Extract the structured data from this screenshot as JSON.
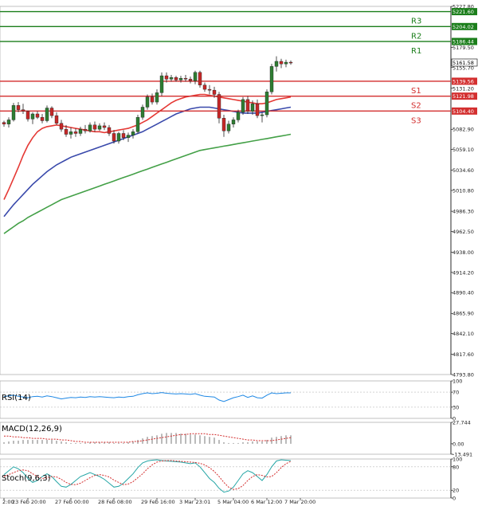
{
  "chart_data": {
    "type": "candlestick",
    "title": "",
    "colors": {
      "up": "#2e7d32",
      "down": "#c62828",
      "ma_fast": "#e53935",
      "ma_mid": "#3949ab",
      "ma_slow": "#43a047",
      "resistance": "#1b7e1b",
      "support": "#d32f2f",
      "rsi": "#1e88e5",
      "macd_hist": "#9e9e9e",
      "macd_signal": "#d32f2f",
      "stoch_main": "#26a6a6",
      "stoch_signal": "#d32f2f",
      "grid": "#cccccc"
    },
    "main": {
      "ylim": [
        4793.8,
        5227.8
      ],
      "y_ticks": [
        "5227.80",
        "5179.50",
        "5155.70",
        "5131.20",
        "5082.90",
        "5059.10",
        "5034.60",
        "5010.80",
        "4986.30",
        "4962.50",
        "4938.00",
        "4914.20",
        "4890.40",
        "4865.90",
        "4842.10",
        "4817.60",
        "4793.80"
      ],
      "levels": [
        {
          "name": "R3",
          "value": 5221.6,
          "label": "5221.60",
          "kind": "resistance"
        },
        {
          "name": "R2",
          "value": 5204.02,
          "label": "5204.02",
          "kind": "resistance"
        },
        {
          "name": "R1",
          "value": 5186.44,
          "label": "5186.44",
          "kind": "resistance"
        },
        {
          "name": "S1",
          "value": 5139.56,
          "label": "5139.56",
          "kind": "support"
        },
        {
          "name": "S2",
          "value": 5121.98,
          "label": "5121.98",
          "kind": "support"
        },
        {
          "name": "S3",
          "value": 5104.4,
          "label": "5104.40",
          "kind": "support"
        }
      ],
      "current_price": {
        "value": 5161.58,
        "label": "5161.58"
      },
      "candles": [
        [
          5091,
          5093,
          5086,
          5089
        ],
        [
          5089,
          5097,
          5085,
          5094
        ],
        [
          5094,
          5114,
          5092,
          5111
        ],
        [
          5111,
          5115,
          5103,
          5106
        ],
        [
          5106,
          5113,
          5101,
          5104
        ],
        [
          5104,
          5105,
          5092,
          5095
        ],
        [
          5095,
          5103,
          5089,
          5101
        ],
        [
          5101,
          5104,
          5095,
          5097
        ],
        [
          5097,
          5101,
          5090,
          5093
        ],
        [
          5093,
          5111,
          5091,
          5108
        ],
        [
          5108,
          5110,
          5096,
          5099
        ],
        [
          5099,
          5103,
          5088,
          5090
        ],
        [
          5090,
          5094,
          5080,
          5083
        ],
        [
          5083,
          5088,
          5074,
          5077
        ],
        [
          5077,
          5085,
          5072,
          5080
        ],
        [
          5080,
          5084,
          5074,
          5078
        ],
        [
          5078,
          5086,
          5075,
          5083
        ],
        [
          5083,
          5088,
          5078,
          5081
        ],
        [
          5081,
          5091,
          5079,
          5088
        ],
        [
          5088,
          5092,
          5080,
          5083
        ],
        [
          5083,
          5090,
          5081,
          5087
        ],
        [
          5087,
          5091,
          5082,
          5085
        ],
        [
          5085,
          5088,
          5075,
          5078
        ],
        [
          5078,
          5082,
          5066,
          5069
        ],
        [
          5069,
          5080,
          5066,
          5078
        ],
        [
          5078,
          5082,
          5070,
          5073
        ],
        [
          5073,
          5079,
          5068,
          5076
        ],
        [
          5076,
          5083,
          5072,
          5080
        ],
        [
          5080,
          5100,
          5078,
          5097
        ],
        [
          5097,
          5112,
          5094,
          5109
        ],
        [
          5109,
          5124,
          5106,
          5121
        ],
        [
          5121,
          5125,
          5112,
          5115
        ],
        [
          5115,
          5130,
          5112,
          5126
        ],
        [
          5126,
          5150,
          5122,
          5146
        ],
        [
          5146,
          5150,
          5138,
          5142
        ],
        [
          5142,
          5147,
          5139,
          5144
        ],
        [
          5144,
          5146,
          5139,
          5141
        ],
        [
          5141,
          5146,
          5138,
          5143
        ],
        [
          5143,
          5147,
          5139,
          5142
        ],
        [
          5142,
          5145,
          5137,
          5140
        ],
        [
          5140,
          5152,
          5136,
          5150
        ],
        [
          5150,
          5152,
          5132,
          5135
        ],
        [
          5135,
          5138,
          5127,
          5130
        ],
        [
          5130,
          5135,
          5124,
          5129
        ],
        [
          5129,
          5133,
          5120,
          5124
        ],
        [
          5124,
          5127,
          5090,
          5096
        ],
        [
          5096,
          5100,
          5074,
          5081
        ],
        [
          5081,
          5093,
          5078,
          5089
        ],
        [
          5089,
          5097,
          5085,
          5094
        ],
        [
          5094,
          5106,
          5091,
          5103
        ],
        [
          5103,
          5121,
          5100,
          5118
        ],
        [
          5118,
          5122,
          5101,
          5104
        ],
        [
          5104,
          5117,
          5100,
          5113
        ],
        [
          5113,
          5118,
          5096,
          5099
        ],
        [
          5099,
          5103,
          5091,
          5100
        ],
        [
          5100,
          5130,
          5097,
          5127
        ],
        [
          5127,
          5160,
          5124,
          5157
        ],
        [
          5157,
          5169,
          5151,
          5163
        ],
        [
          5163,
          5166,
          5155,
          5160
        ],
        [
          5160,
          5165,
          5156,
          5162
        ],
        [
          5162,
          5164,
          5159,
          5161.58
        ]
      ],
      "ma_fast": [
        5000,
        5012,
        5025,
        5038,
        5052,
        5064,
        5073,
        5080,
        5084,
        5086,
        5087,
        5088,
        5087,
        5086,
        5085,
        5084,
        5083,
        5082,
        5081,
        5080,
        5080,
        5079,
        5080,
        5081,
        5082,
        5083,
        5084,
        5086,
        5088,
        5091,
        5094,
        5098,
        5102,
        5106,
        5110,
        5114,
        5117,
        5119,
        5121,
        5122,
        5123,
        5124,
        5124,
        5123,
        5122,
        5121,
        5120,
        5119,
        5118,
        5117,
        5116,
        5115,
        5114,
        5113,
        5113,
        5114,
        5116,
        5118,
        5119,
        5120,
        5121
      ],
      "ma_mid": [
        4980,
        4987,
        4994,
        5000,
        5006,
        5012,
        5018,
        5023,
        5028,
        5033,
        5037,
        5041,
        5044,
        5047,
        5050,
        5052,
        5054,
        5056,
        5058,
        5060,
        5062,
        5064,
        5066,
        5068,
        5070,
        5072,
        5074,
        5076,
        5078,
        5080,
        5083,
        5086,
        5089,
        5092,
        5095,
        5098,
        5101,
        5103,
        5105,
        5107,
        5108,
        5109,
        5109,
        5109,
        5108,
        5107,
        5106,
        5105,
        5104,
        5103,
        5102,
        5102,
        5102,
        5102,
        5103,
        5104,
        5105,
        5106,
        5107,
        5108,
        5109
      ],
      "ma_slow": [
        4960,
        4964,
        4968,
        4972,
        4975,
        4979,
        4982,
        4985,
        4988,
        4991,
        4994,
        4997,
        5000,
        5002,
        5004,
        5006,
        5008,
        5010,
        5012,
        5014,
        5016,
        5018,
        5020,
        5022,
        5024,
        5026,
        5028,
        5030,
        5032,
        5034,
        5036,
        5038,
        5040,
        5042,
        5044,
        5046,
        5048,
        5050,
        5052,
        5054,
        5056,
        5058,
        5059,
        5060,
        5061,
        5062,
        5063,
        5064,
        5065,
        5066,
        5067,
        5068,
        5069,
        5070,
        5071,
        5072,
        5073,
        5074,
        5075,
        5076,
        5077
      ]
    },
    "rsi": {
      "label": "RSI(14)",
      "ylim": [
        0,
        100
      ],
      "y_ticks": [
        "100",
        "70",
        "30",
        "0"
      ],
      "values": [
        58,
        60,
        62,
        59,
        57,
        55,
        58,
        59,
        57,
        60,
        58,
        55,
        52,
        54,
        56,
        55,
        57,
        56,
        58,
        57,
        58,
        57,
        56,
        55,
        57,
        56,
        58,
        59,
        63,
        66,
        68,
        66,
        67,
        69,
        67,
        66,
        65,
        66,
        65,
        64,
        66,
        62,
        59,
        58,
        57,
        49,
        45,
        50,
        55,
        58,
        62,
        56,
        60,
        55,
        54,
        62,
        68,
        66,
        67,
        68,
        68
      ]
    },
    "macd": {
      "label": "MACD(12,26,9)",
      "ylim": [
        -13.491,
        27.744
      ],
      "y_ticks": [
        "27.744",
        "0.00",
        "-13.491"
      ],
      "hist": [
        2,
        3,
        4,
        4,
        5,
        5,
        5,
        5,
        5,
        5,
        5,
        4,
        3,
        2,
        1,
        1,
        1,
        1,
        2,
        2,
        2,
        2,
        2,
        1,
        1,
        1,
        2,
        3,
        5,
        7,
        9,
        10,
        11,
        13,
        14,
        14,
        14,
        13,
        13,
        12,
        12,
        11,
        10,
        9,
        8,
        5,
        2,
        1,
        1,
        1,
        2,
        2,
        3,
        3,
        3,
        5,
        8,
        9,
        10,
        11,
        11
      ],
      "signal": [
        10,
        10,
        9,
        9,
        8,
        8,
        7,
        7,
        7,
        6,
        6,
        6,
        5,
        5,
        4,
        3,
        3,
        2,
        2,
        2,
        2,
        2,
        2,
        2,
        2,
        2,
        2,
        3,
        3,
        4,
        5,
        6,
        7,
        8,
        9,
        10,
        11,
        12,
        12,
        13,
        13,
        13,
        13,
        12,
        12,
        11,
        10,
        9,
        8,
        7,
        6,
        5,
        5,
        4,
        4,
        4,
        4,
        5,
        6,
        7,
        8
      ]
    },
    "stoch": {
      "label": "Stoch(9,6,3)",
      "ylim": [
        0,
        100
      ],
      "y_ticks": [
        "100",
        "80",
        "20",
        "0"
      ],
      "main": [
        60,
        70,
        80,
        75,
        65,
        50,
        40,
        45,
        55,
        62,
        55,
        42,
        30,
        28,
        35,
        45,
        55,
        60,
        65,
        60,
        55,
        48,
        38,
        28,
        30,
        38,
        50,
        62,
        78,
        90,
        95,
        97,
        98,
        96,
        95,
        94,
        93,
        92,
        90,
        88,
        90,
        80,
        65,
        50,
        40,
        25,
        15,
        18,
        28,
        45,
        62,
        70,
        65,
        55,
        45,
        60,
        80,
        95,
        98,
        97,
        96
      ],
      "signal": [
        55,
        60,
        65,
        70,
        72,
        70,
        62,
        55,
        50,
        52,
        55,
        54,
        48,
        40,
        35,
        34,
        38,
        45,
        52,
        58,
        60,
        58,
        54,
        46,
        40,
        34,
        36,
        42,
        52,
        62,
        75,
        85,
        92,
        95,
        96,
        96,
        95,
        94,
        93,
        92,
        91,
        89,
        85,
        78,
        68,
        55,
        40,
        28,
        22,
        24,
        32,
        45,
        55,
        60,
        58,
        54,
        55,
        65,
        78,
        88,
        94
      ]
    },
    "x_labels": [
      {
        "text": "2:00",
        "index": 0
      },
      {
        "text": "23 Feb 20:00",
        "index": 5
      },
      {
        "text": "27 Feb 00:00",
        "index": 14
      },
      {
        "text": "28 Feb 08:00",
        "index": 23
      },
      {
        "text": "29 Feb 16:00",
        "index": 32
      },
      {
        "text": "3 Mar 23:01",
        "index": 40
      },
      {
        "text": "5 Mar 04:00",
        "index": 48
      },
      {
        "text": "6 Mar 12:00",
        "index": 55
      },
      {
        "text": "7 Mar 20:00",
        "index": 62
      }
    ]
  }
}
